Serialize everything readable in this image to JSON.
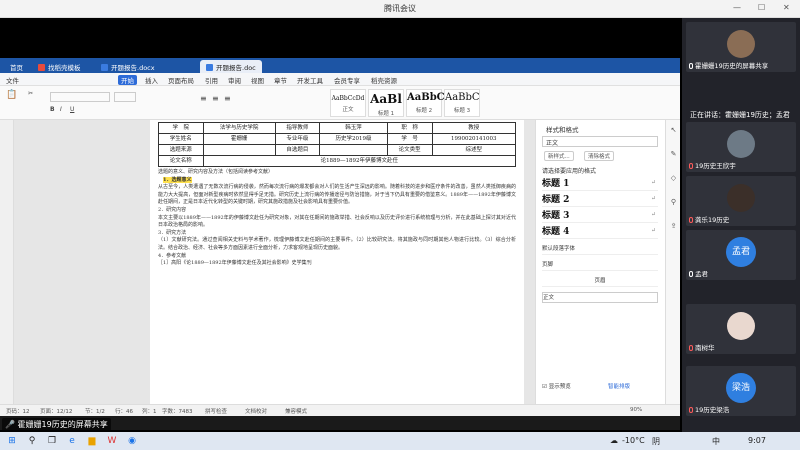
{
  "app": {
    "window_title": "腾讯会议"
  },
  "wps": {
    "tabs": [
      {
        "label": "首页",
        "active": false
      },
      {
        "label": "找稻壳模板",
        "active": false
      },
      {
        "label": "开题报告.docx",
        "active": false
      },
      {
        "label": "开题报告.doc",
        "active": true
      }
    ],
    "menus": [
      "文件",
      "开始",
      "插入",
      "页面布局",
      "引用",
      "审阅",
      "视图",
      "章节",
      "开发工具",
      "会员专享",
      "稻壳资源"
    ],
    "active_menu": "开始",
    "styles": [
      {
        "sample": "AaBbCcDd",
        "label": "正文"
      },
      {
        "sample": "AaBl",
        "label": "标题 1"
      },
      {
        "sample": "AaBbC",
        "label": "标题 2"
      },
      {
        "sample": "AaBbC",
        "label": "标题 3"
      }
    ],
    "doc": {
      "table": {
        "row1": [
          "学　院",
          "法学与历史学院",
          "指导教师",
          "韩玉萍",
          "职　称",
          "教授"
        ],
        "row2": [
          "学生姓名",
          "霍姗姗",
          "专业年级",
          "历史学2019级",
          "学　号",
          "1990020141003"
        ],
        "row3": [
          "选题来源",
          "",
          "自选题目",
          "",
          "论文类型",
          "综述型"
        ],
        "row4": [
          "论文名称",
          "论1889—1892年伊藤博文赴任"
        ]
      },
      "section_title": "选题的意义、研究内容及方法（包括阅读参考文献）",
      "heading1": "1．选题意义",
      "para1": "从古至今，人类遭遇了无数次流行病的侵袭，然而每次流行病的爆发都会对人们的生活产生深远的影响。随着科技的进步和医疗条件的改善，虽然人类抵御疾病的能力大大提高，但面对新型疾病时依然显得手足无措。研究历史上流行病的传播途径与防治措施，对于当下仍具有重要的借鉴意义。1889年——1892年伊藤博文赴任期间，正是日本近代化转型的关键时期，研究其施政措施及社会影响具有重要价值。",
      "heading2": "2．研究内容",
      "para2": "本文主要以1889年——1892年的伊藤博文赴任为研究对象，对其在任期间的施政举措、社会反响以及历史评价进行系统梳理与分析，并在此基础上探讨其对近代日本政治格局的影响。",
      "heading3": "3．研究方法",
      "para3": "（1）文献研究法。通过查阅相关史料与学术著作，梳理伊藤博文赴任期间的主要事件。（2）比较研究法。将其施政与同时期其他人物进行比较。（3）综合分析法。结合政治、经济、社会等多方面因素进行全面分析，力求客观地呈现历史面貌。",
      "heading4": "4．参考文献",
      "ref1": "［1］高阳《论1889—1892年伊藤博文赴任及其社会影响》史学集刊"
    },
    "style_panel": {
      "title": "样式和格式",
      "current": "正文",
      "buttons": [
        "新样式...",
        "清除格式"
      ],
      "sub_title": "请选择要应用的格式",
      "headings": [
        "标题 1",
        "标题 2",
        "标题 3",
        "标题 4"
      ],
      "small_items": [
        "默认段落字体",
        "页脚",
        "页眉",
        "正文"
      ],
      "show_preview": "显示预览",
      "smart_format": "智能排版"
    },
    "status": [
      "页码：12",
      "页面：12/12",
      "节：1/2",
      "行：46",
      "列：1",
      "字数：7483",
      "拼写检查",
      "文档校对",
      "兼容模式"
    ],
    "zoom": "90%"
  },
  "meeting": {
    "share_label": "霍姗姗19历史的屏幕共享",
    "speaking": "正在讲话：霍姗姗19历史；孟君",
    "participants": [
      {
        "name": "霍姗姗19历史的屏幕共享",
        "type": "photo",
        "muted": false
      },
      {
        "name": "19历史王欣宇",
        "type": "photo",
        "muted": true
      },
      {
        "name": "龚乐19历史",
        "type": "photo",
        "muted": true
      },
      {
        "name": "孟君",
        "type": "initial",
        "initial": "孟君",
        "muted": false
      },
      {
        "name": "南树华",
        "type": "photo",
        "muted": true
      },
      {
        "name": "19历史梁浩",
        "type": "initial",
        "initial": "梁浩",
        "muted": true
      }
    ]
  },
  "taskbar": {
    "temp": "-10°C",
    "weather": "阴",
    "lang": "中",
    "time": "9:07"
  }
}
